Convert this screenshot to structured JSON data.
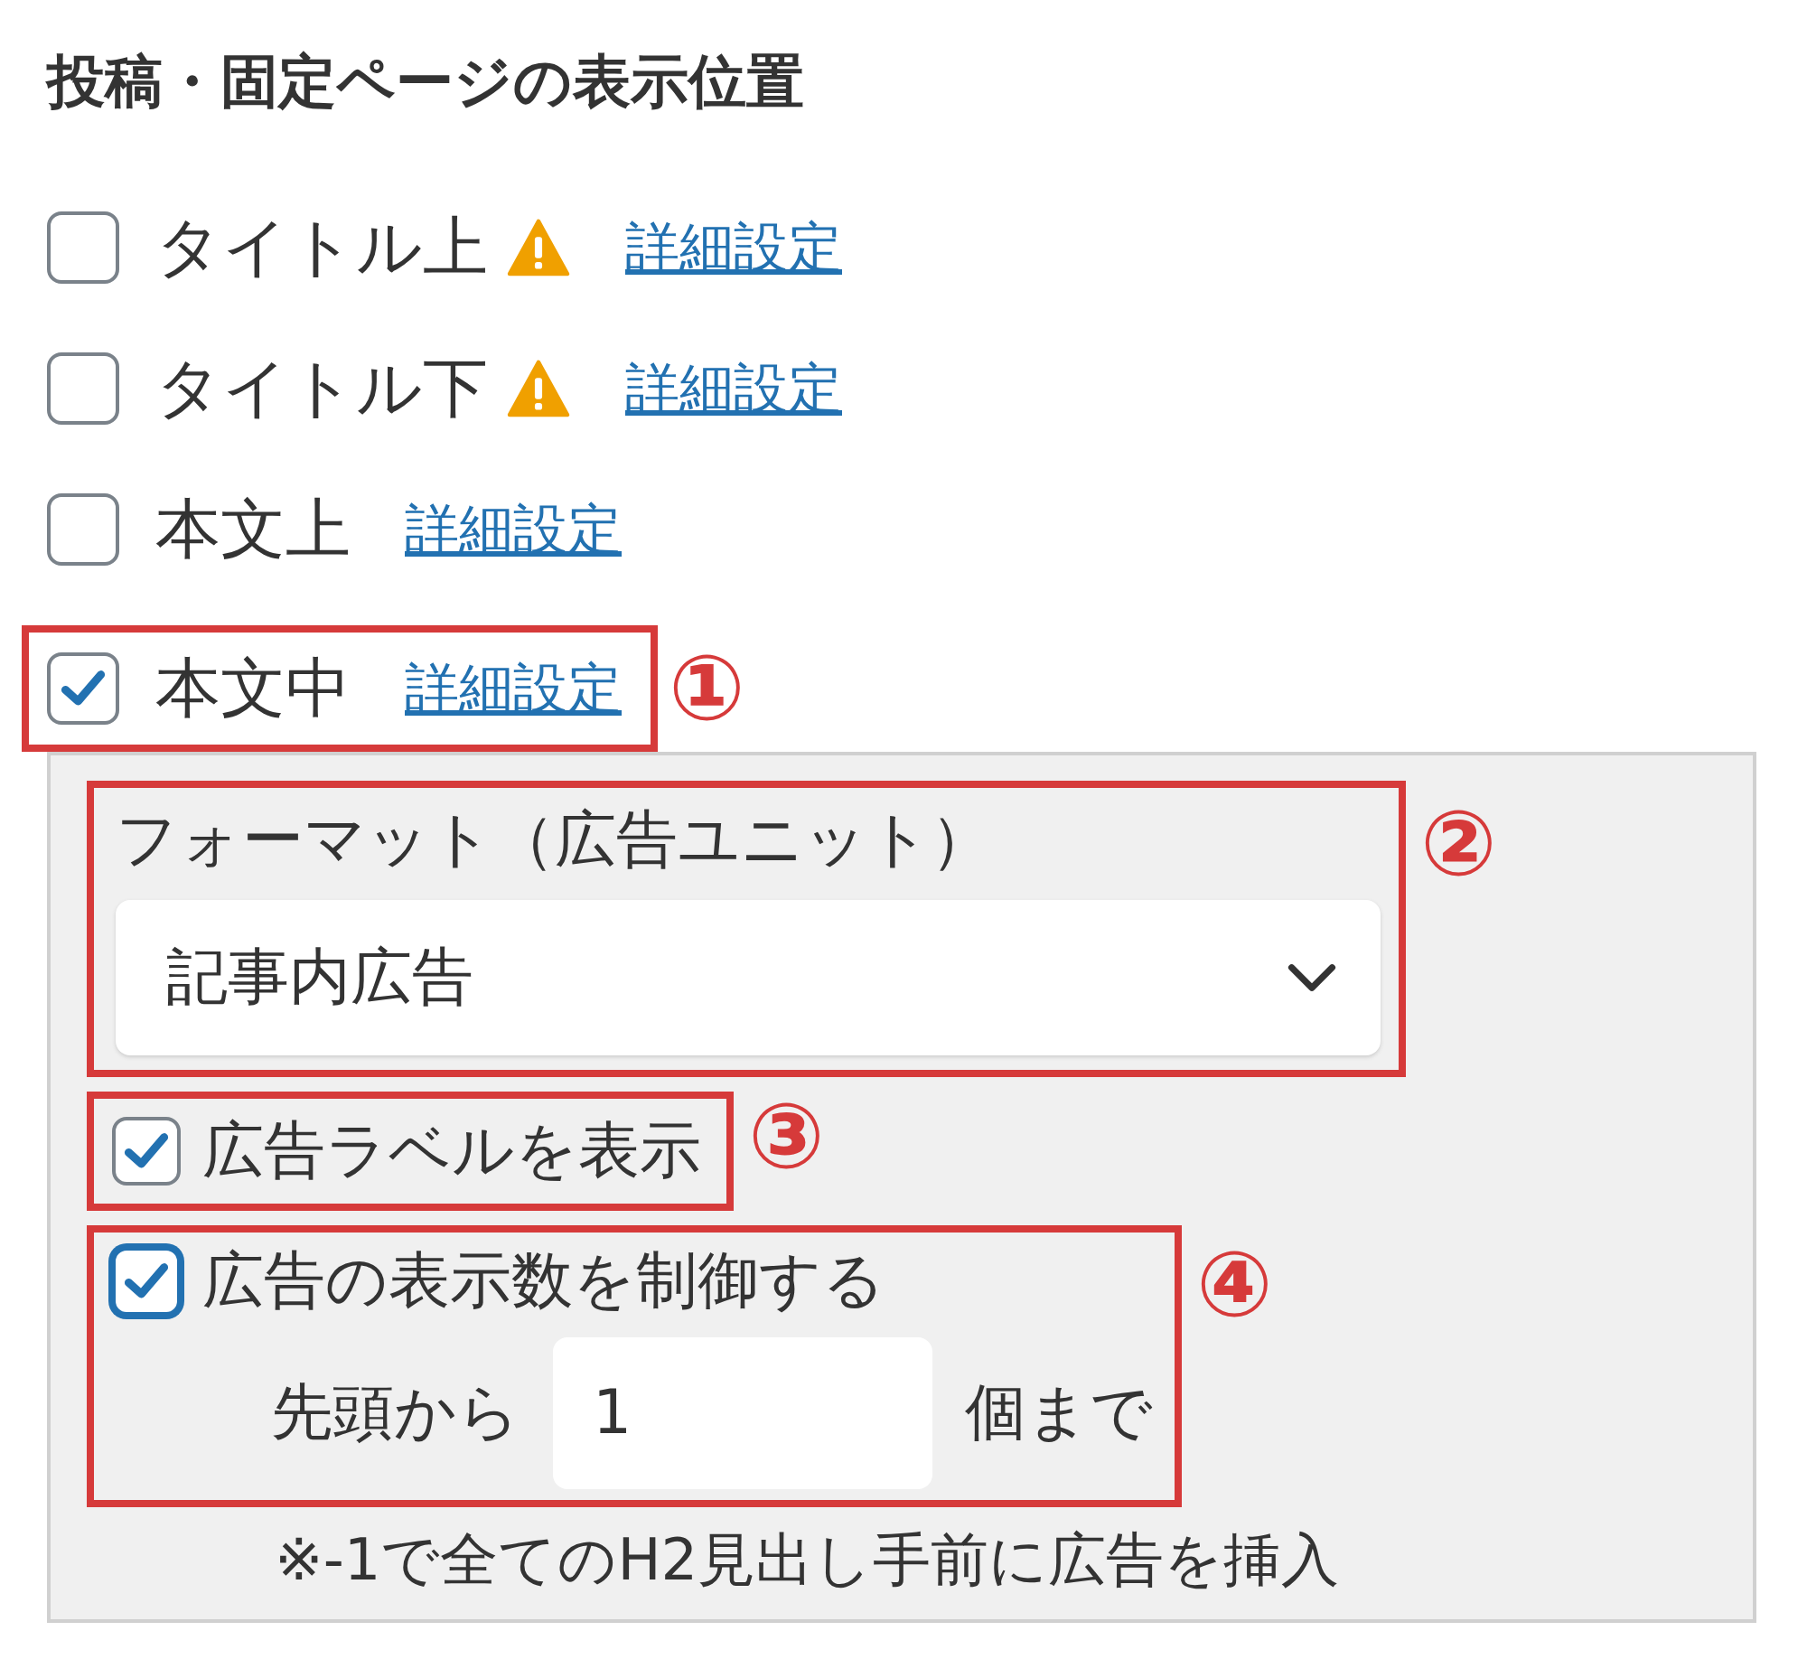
{
  "heading": "投稿・固定ページの表示位置",
  "positions": [
    {
      "label": "タイトル上",
      "checked": false,
      "warning": true,
      "link": "詳細設定"
    },
    {
      "label": "タイトル下",
      "checked": false,
      "warning": true,
      "link": "詳細設定"
    },
    {
      "label": "本文上",
      "checked": false,
      "warning": false,
      "link": "詳細設定"
    },
    {
      "label": "本文中",
      "checked": true,
      "warning": false,
      "link": "詳細設定",
      "annotation": "①"
    }
  ],
  "panel": {
    "format": {
      "label": "フォーマット（広告ユニット）",
      "value": "記事内広告",
      "annotation": "②"
    },
    "show_label": {
      "label": "広告ラベルを表示",
      "checked": true,
      "annotation": "③"
    },
    "limit": {
      "label": "広告の表示数を制御する",
      "checked": true,
      "prefix": "先頭から",
      "value": "1",
      "suffix": "個まで",
      "annotation": "④"
    },
    "note": "※-1で全てのH2見出し手前に広告を挿入"
  }
}
